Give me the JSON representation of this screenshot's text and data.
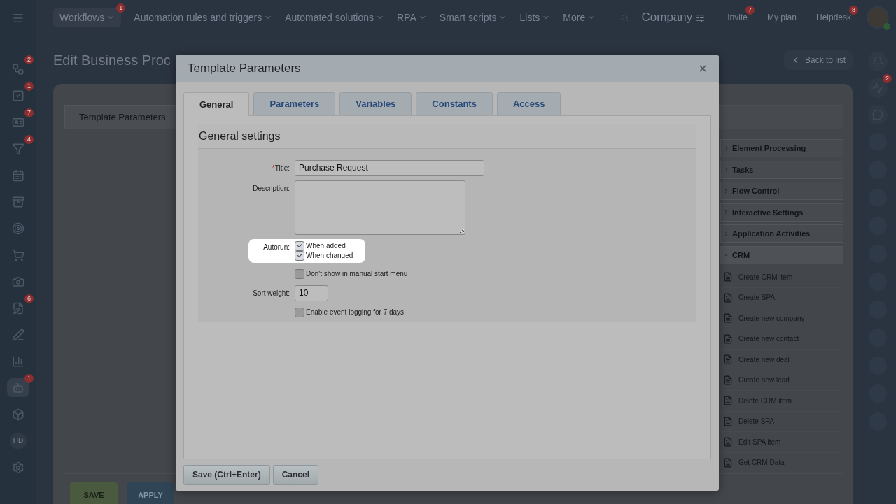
{
  "sidebar": {
    "items": [
      {
        "kind": "flow",
        "badge": "2",
        "selected": false
      },
      {
        "kind": "tasks",
        "badge": "1",
        "selected": false
      },
      {
        "kind": "card",
        "badge": "7",
        "selected": false
      },
      {
        "kind": "funnel",
        "badge": "4",
        "selected": false
      },
      {
        "kind": "calendar",
        "selected": false
      },
      {
        "kind": "inbox",
        "selected": false
      },
      {
        "kind": "target",
        "selected": false
      },
      {
        "kind": "cart",
        "selected": false
      },
      {
        "kind": "camera",
        "selected": false
      },
      {
        "kind": "doc",
        "badge": "6",
        "selected": false
      },
      {
        "kind": "pen",
        "selected": false
      },
      {
        "kind": "chart",
        "selected": false
      },
      {
        "kind": "robot",
        "badge": "1",
        "selected": true
      },
      {
        "kind": "box",
        "selected": false
      },
      {
        "kind": "text",
        "label": "HD",
        "selected": false
      },
      {
        "kind": "gear",
        "selected": false
      }
    ]
  },
  "topnav": {
    "items": [
      {
        "label": "Workflows",
        "badge": "1",
        "selected": true
      },
      {
        "label": "Automation rules and triggers",
        "selected": false
      },
      {
        "label": "Automated solutions",
        "selected": false
      },
      {
        "label": "RPA",
        "selected": false
      },
      {
        "label": "Smart scripts",
        "selected": false
      },
      {
        "label": "Lists",
        "selected": false
      },
      {
        "label": "More",
        "selected": false
      }
    ],
    "company": "Company",
    "buttons": [
      {
        "label": "Invite",
        "badge": "7"
      },
      {
        "label": "My plan"
      },
      {
        "label": "Helpdesk",
        "badge": "8"
      }
    ]
  },
  "page": {
    "title": "Edit Business Proc",
    "back_button": "Back to list",
    "chip": "Template Parameters",
    "activity_groups": [
      {
        "label": "Element Processing",
        "expanded": false
      },
      {
        "label": "Tasks",
        "expanded": false
      },
      {
        "label": "Flow Control",
        "expanded": false
      },
      {
        "label": "Interactive Settings",
        "expanded": false
      },
      {
        "label": "Application Activities",
        "expanded": false
      },
      {
        "label": "CRM",
        "expanded": true,
        "children": [
          {
            "label": "Create CRM item"
          },
          {
            "label": "Create SPA"
          },
          {
            "label": "Create new company"
          },
          {
            "label": "Create new contact"
          },
          {
            "label": "Create new deal"
          },
          {
            "label": "Create new lead"
          },
          {
            "label": "Delete CRM item"
          },
          {
            "label": "Delete SPA"
          },
          {
            "label": "Edit SPA item"
          },
          {
            "label": "Get CRM Data"
          }
        ]
      }
    ],
    "buttons": [
      {
        "label": "SAVE",
        "kind": "primary"
      },
      {
        "label": "APPLY",
        "kind": "secondary"
      }
    ]
  },
  "right_rail": {
    "items": [
      {
        "kind": "bell"
      },
      {
        "kind": "pulse",
        "badge": "2"
      },
      {
        "kind": "chat"
      },
      {
        "kind": "avatar"
      },
      {
        "kind": "avatar"
      },
      {
        "kind": "avatar"
      },
      {
        "kind": "avatar"
      },
      {
        "kind": "avatar"
      },
      {
        "kind": "avatar"
      },
      {
        "kind": "avatar"
      },
      {
        "kind": "avatar"
      },
      {
        "kind": "avatar"
      },
      {
        "kind": "avatar"
      },
      {
        "kind": "avatar"
      }
    ]
  },
  "dialog": {
    "title": "Template Parameters",
    "tabs": [
      {
        "label": "General",
        "selected": true
      },
      {
        "label": "Parameters",
        "selected": false
      },
      {
        "label": "Variables",
        "selected": false
      },
      {
        "label": "Constants",
        "selected": false
      },
      {
        "label": "Access",
        "selected": false
      }
    ],
    "section": "General settings",
    "fields": [
      {
        "kind": "text",
        "label": "Title:",
        "required_mark": "*",
        "value": "Purchase Request"
      },
      {
        "kind": "textarea",
        "label": "Description:"
      },
      {
        "kind": "checks",
        "label": "Autorun:",
        "highlighted": true,
        "options": [
          {
            "label": "When added",
            "checked": true
          },
          {
            "label": "When changed",
            "checked": true
          }
        ]
      },
      {
        "kind": "checks",
        "highlighted": false,
        "options": [
          {
            "label": "Don't show in manual start menu",
            "checked": false
          }
        ]
      },
      {
        "kind": "number",
        "label": "Sort weight:",
        "value": "10"
      },
      {
        "kind": "checks",
        "highlighted": false,
        "options": [
          {
            "label": "Enable event logging for 7 days",
            "checked": false
          }
        ]
      }
    ],
    "buttons": [
      "Save (Ctrl+Enter)",
      "Cancel"
    ]
  }
}
